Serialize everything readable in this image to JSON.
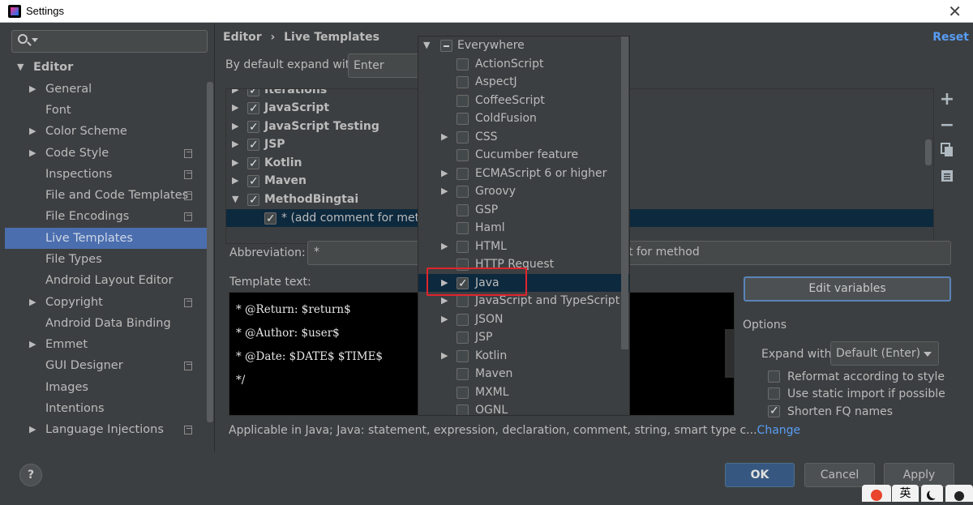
{
  "window": {
    "title": "Settings"
  },
  "sidebar": {
    "search_placeholder": "",
    "items": [
      {
        "label": "Editor",
        "level": 0,
        "expanded": true
      },
      {
        "label": "General",
        "level": 1,
        "arrow": true
      },
      {
        "label": "Font",
        "level": 1
      },
      {
        "label": "Color Scheme",
        "level": 1,
        "arrow": true
      },
      {
        "label": "Code Style",
        "level": 1,
        "arrow": true,
        "copy": true
      },
      {
        "label": "Inspections",
        "level": 1,
        "copy": true
      },
      {
        "label": "File and Code Templates",
        "level": 1,
        "copy": true
      },
      {
        "label": "File Encodings",
        "level": 1,
        "copy": true
      },
      {
        "label": "Live Templates",
        "level": 1,
        "selected": true
      },
      {
        "label": "File Types",
        "level": 1
      },
      {
        "label": "Android Layout Editor",
        "level": 1
      },
      {
        "label": "Copyright",
        "level": 1,
        "arrow": true,
        "copy": true
      },
      {
        "label": "Android Data Binding",
        "level": 1
      },
      {
        "label": "Emmet",
        "level": 1,
        "arrow": true
      },
      {
        "label": "GUI Designer",
        "level": 1,
        "copy": true
      },
      {
        "label": "Images",
        "level": 1
      },
      {
        "label": "Intentions",
        "level": 1
      },
      {
        "label": "Language Injections",
        "level": 1,
        "arrow": true,
        "copy": true
      }
    ]
  },
  "main": {
    "breadcrumb": {
      "part1": "Editor",
      "sep": "›",
      "part2": "Live Templates"
    },
    "reset": "Reset",
    "expand_label": "By default expand with",
    "expand_value": "Enter",
    "template_groups": [
      {
        "label": "Iterations",
        "checked": true,
        "partial": true
      },
      {
        "label": "JavaScript",
        "checked": true
      },
      {
        "label": "JavaScript Testing",
        "checked": true
      },
      {
        "label": "JSP",
        "checked": true
      },
      {
        "label": "Kotlin",
        "checked": true
      },
      {
        "label": "Maven",
        "checked": true
      },
      {
        "label": "MethodBingtai",
        "checked": true,
        "expanded": true
      }
    ],
    "selected_template": "* (add comment for metho",
    "tools": {
      "add": "+",
      "remove": "−"
    },
    "abbreviation_label": "Abbreviation:",
    "abbreviation_value": "*",
    "description_value": "t for method",
    "template_text_label": "Template text:",
    "template_lines": [
      "* @Return: $return$",
      "* @Author: $user$",
      "* @Date: $DATE$ $TIME$",
      "*/"
    ],
    "edit_variables": "Edit variables",
    "options_label": "Options",
    "expand_with_label": "Expand with",
    "expand_with_value": "Default (Enter)",
    "options": [
      {
        "label": "Reformat according to style",
        "checked": false
      },
      {
        "label": "Use static import if possible",
        "checked": false
      },
      {
        "label": "Shorten FQ names",
        "checked": true
      }
    ],
    "applicable_text": "Applicable in Java; Java: statement, expression, declaration, comment, string, smart type c...",
    "change_link": "Change"
  },
  "context_popup": {
    "root": "Everywhere",
    "items": [
      {
        "label": "ActionScript",
        "checked": false,
        "arrow": false
      },
      {
        "label": "AspectJ",
        "checked": false,
        "arrow": false
      },
      {
        "label": "CoffeeScript",
        "checked": false,
        "arrow": false
      },
      {
        "label": "ColdFusion",
        "checked": false,
        "arrow": false
      },
      {
        "label": "CSS",
        "checked": false,
        "arrow": true
      },
      {
        "label": "Cucumber feature",
        "checked": false,
        "arrow": false
      },
      {
        "label": "ECMAScript 6 or higher",
        "checked": false,
        "arrow": true
      },
      {
        "label": "Groovy",
        "checked": false,
        "arrow": true
      },
      {
        "label": "GSP",
        "checked": false,
        "arrow": false
      },
      {
        "label": "Haml",
        "checked": false,
        "arrow": false
      },
      {
        "label": "HTML",
        "checked": false,
        "arrow": true
      },
      {
        "label": "HTTP Request",
        "checked": false,
        "arrow": false
      },
      {
        "label": "Java",
        "checked": true,
        "arrow": true,
        "selected": true
      },
      {
        "label": "JavaScript and TypeScript",
        "checked": false,
        "arrow": true
      },
      {
        "label": "JSON",
        "checked": false,
        "arrow": true
      },
      {
        "label": "JSP",
        "checked": false,
        "arrow": false
      },
      {
        "label": "Kotlin",
        "checked": false,
        "arrow": true
      },
      {
        "label": "Maven",
        "checked": false,
        "arrow": false
      },
      {
        "label": "MXML",
        "checked": false,
        "arrow": false
      },
      {
        "label": "OGNL",
        "checked": false,
        "arrow": false
      }
    ]
  },
  "footer": {
    "help": "?",
    "ok": "OK",
    "cancel": "Cancel",
    "apply": "Apply"
  },
  "tray": {
    "ime": "英"
  },
  "colors": {
    "accent": "#4b6eaf",
    "link": "#589df6",
    "highlight": "#e0242e",
    "ok_button": "#365880"
  }
}
